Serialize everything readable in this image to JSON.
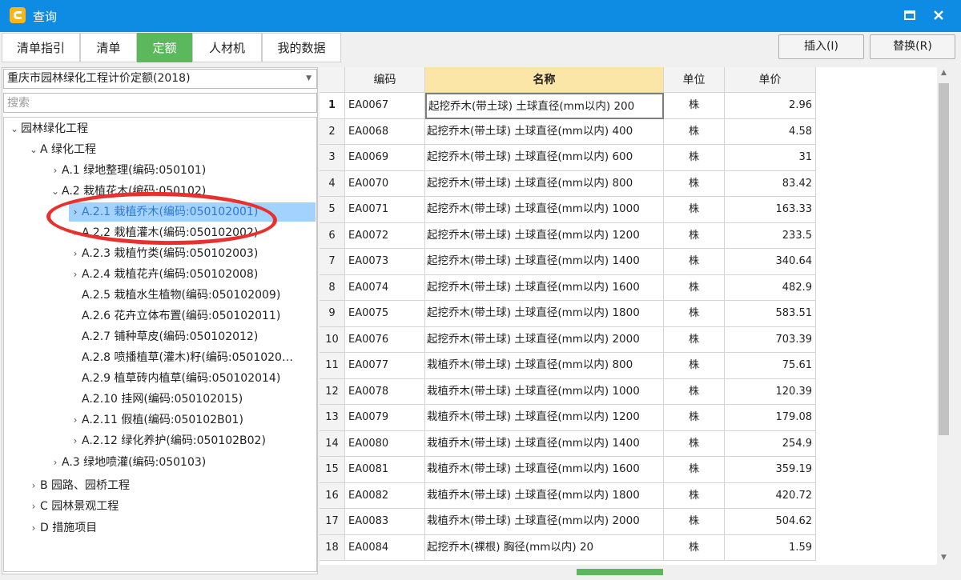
{
  "window": {
    "title": "查询",
    "icon": "app-logo-icon",
    "accent": "#0e8ce4"
  },
  "tabs": [
    {
      "label": "清单指引",
      "active": false
    },
    {
      "label": "清单",
      "active": false
    },
    {
      "label": "定额",
      "active": true
    },
    {
      "label": "人材机",
      "active": false
    },
    {
      "label": "我的数据",
      "active": false
    }
  ],
  "toolbar": {
    "insert_label": "插入(I)",
    "replace_label": "替换(R)"
  },
  "left": {
    "quota_select": "重庆市园林绿化工程计价定额(2018)",
    "search_placeholder": "搜索",
    "tree": [
      {
        "label": "园林绿化工程",
        "expanded": true
      },
      {
        "label": "A 绿化工程",
        "expanded": true
      },
      {
        "label": "A.1 绿地整理(编码:050101)",
        "expanded": false
      },
      {
        "label": "A.2 栽植花木(编码:050102)",
        "expanded": true
      },
      {
        "label": "A.2.1 栽植乔木(编码:050102001)",
        "expanded": false,
        "selected": true
      },
      {
        "label": "A.2.2 栽植灌木(编码:050102002)",
        "expanded": false
      },
      {
        "label": "A.2.3 栽植竹类(编码:050102003)",
        "expanded": false
      },
      {
        "label": "A.2.4 栽植花卉(编码:050102008)",
        "expanded": false
      },
      {
        "label": "A.2.5 栽植水生植物(编码:050102009)"
      },
      {
        "label": "A.2.6 花卉立体布置(编码:050102011)"
      },
      {
        "label": "A.2.7 铺种草皮(编码:050102012)"
      },
      {
        "label": "A.2.8 喷播植草(灌木)籽(编码:0501020…"
      },
      {
        "label": "A.2.9 植草砖内植草(编码:050102014)"
      },
      {
        "label": "A.2.10 挂网(编码:050102015)"
      },
      {
        "label": "A.2.11 假植(编码:050102B01)",
        "expanded": false
      },
      {
        "label": "A.2.12 绿化养护(编码:050102B02)",
        "expanded": false
      },
      {
        "label": "A.3 绿地喷灌(编码:050103)",
        "expanded": false
      },
      {
        "label": "B 园路、园桥工程",
        "expanded": false
      },
      {
        "label": "C 园林景观工程",
        "expanded": false
      },
      {
        "label": "D 措施项目",
        "expanded": false
      }
    ]
  },
  "table": {
    "columns": [
      "",
      "编码",
      "名称",
      "单位",
      "单价"
    ],
    "rows": [
      {
        "n": "1",
        "code": "EA0067",
        "name": "起挖乔木(带土球) 土球直径(mm以内) 200",
        "unit": "株",
        "price": "2.96"
      },
      {
        "n": "2",
        "code": "EA0068",
        "name": "起挖乔木(带土球) 土球直径(mm以内) 400",
        "unit": "株",
        "price": "4.58"
      },
      {
        "n": "3",
        "code": "EA0069",
        "name": "起挖乔木(带土球) 土球直径(mm以内) 600",
        "unit": "株",
        "price": "31"
      },
      {
        "n": "4",
        "code": "EA0070",
        "name": "起挖乔木(带土球) 土球直径(mm以内) 800",
        "unit": "株",
        "price": "83.42"
      },
      {
        "n": "5",
        "code": "EA0071",
        "name": "起挖乔木(带土球) 土球直径(mm以内) 1000",
        "unit": "株",
        "price": "163.33"
      },
      {
        "n": "6",
        "code": "EA0072",
        "name": "起挖乔木(带土球) 土球直径(mm以内) 1200",
        "unit": "株",
        "price": "233.5"
      },
      {
        "n": "7",
        "code": "EA0073",
        "name": "起挖乔木(带土球) 土球直径(mm以内) 1400",
        "unit": "株",
        "price": "340.64"
      },
      {
        "n": "8",
        "code": "EA0074",
        "name": "起挖乔木(带土球) 土球直径(mm以内) 1600",
        "unit": "株",
        "price": "482.9"
      },
      {
        "n": "9",
        "code": "EA0075",
        "name": "起挖乔木(带土球) 土球直径(mm以内) 1800",
        "unit": "株",
        "price": "583.51"
      },
      {
        "n": "10",
        "code": "EA0076",
        "name": "起挖乔木(带土球) 土球直径(mm以内) 2000",
        "unit": "株",
        "price": "703.39"
      },
      {
        "n": "11",
        "code": "EA0077",
        "name": "栽植乔木(带土球) 土球直径(mm以内) 800",
        "unit": "株",
        "price": "75.61"
      },
      {
        "n": "12",
        "code": "EA0078",
        "name": "栽植乔木(带土球) 土球直径(mm以内) 1000",
        "unit": "株",
        "price": "120.39"
      },
      {
        "n": "13",
        "code": "EA0079",
        "name": "栽植乔木(带土球) 土球直径(mm以内) 1200",
        "unit": "株",
        "price": "179.08"
      },
      {
        "n": "14",
        "code": "EA0080",
        "name": "栽植乔木(带土球) 土球直径(mm以内) 1400",
        "unit": "株",
        "price": "254.9"
      },
      {
        "n": "15",
        "code": "EA0081",
        "name": "栽植乔木(带土球) 土球直径(mm以内) 1600",
        "unit": "株",
        "price": "359.19"
      },
      {
        "n": "16",
        "code": "EA0082",
        "name": "栽植乔木(带土球) 土球直径(mm以内) 1800",
        "unit": "株",
        "price": "420.72"
      },
      {
        "n": "17",
        "code": "EA0083",
        "name": "栽植乔木(带土球) 土球直径(mm以内) 2000",
        "unit": "株",
        "price": "504.62"
      },
      {
        "n": "18",
        "code": "EA0084",
        "name": "起挖乔木(裸根) 胸径(mm以内) 20",
        "unit": "株",
        "price": "1.59"
      }
    ]
  }
}
